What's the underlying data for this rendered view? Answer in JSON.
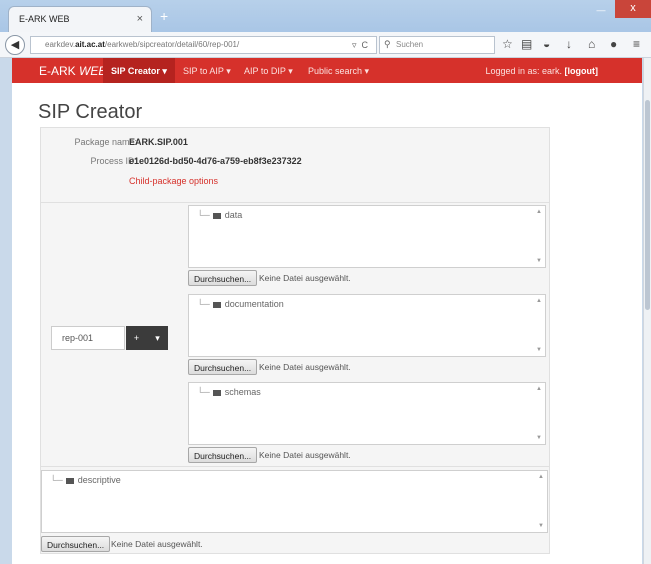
{
  "browser": {
    "tab_title": "E-ARK WEB",
    "tab_close": "×",
    "new_tab": "+",
    "win_min": "—",
    "win_close": "x",
    "url_host": "earkdev.",
    "url_domain": "ait.ac.at",
    "url_path": "/earkweb/sipcreator/detail/60/rep-001/",
    "search_placeholder": "Suchen",
    "icons": [
      "back-icon",
      "info-icon",
      "dropdown-icon",
      "reload-icon",
      "search-icon",
      "star-icon",
      "library-icon",
      "pocket-icon",
      "download-icon",
      "home-icon",
      "chat-icon",
      "menu-icon"
    ]
  },
  "appbar": {
    "brand_prefix": "E-ARK ",
    "brand_suffix": "WEB",
    "menu": [
      "SIP Creator ▾",
      "SIP to AIP ▾",
      "AIP to DIP ▾",
      "Public search ▾"
    ],
    "logged_in_prefix": "Logged in as: eark. ",
    "logout": "[logout]"
  },
  "page": {
    "title": "SIP Creator"
  },
  "package": {
    "name_label": "Package name:",
    "name_value": "EARK.SIP.001",
    "process_label": "Process ID:",
    "process_value": "e1e0126d-bd50-4d76-a759-eb8f3e237322",
    "child_options": "Child-package options"
  },
  "representation": {
    "input_value": "rep-001",
    "add_label": "+",
    "dropdown_label": "▾"
  },
  "folders": [
    {
      "name": "data"
    },
    {
      "name": "documentation"
    },
    {
      "name": "schemas"
    }
  ],
  "descriptive": {
    "name": "descriptive"
  },
  "file_input": {
    "button": "Durchsuchen...",
    "status": "Keine Datei ausgewählt."
  }
}
